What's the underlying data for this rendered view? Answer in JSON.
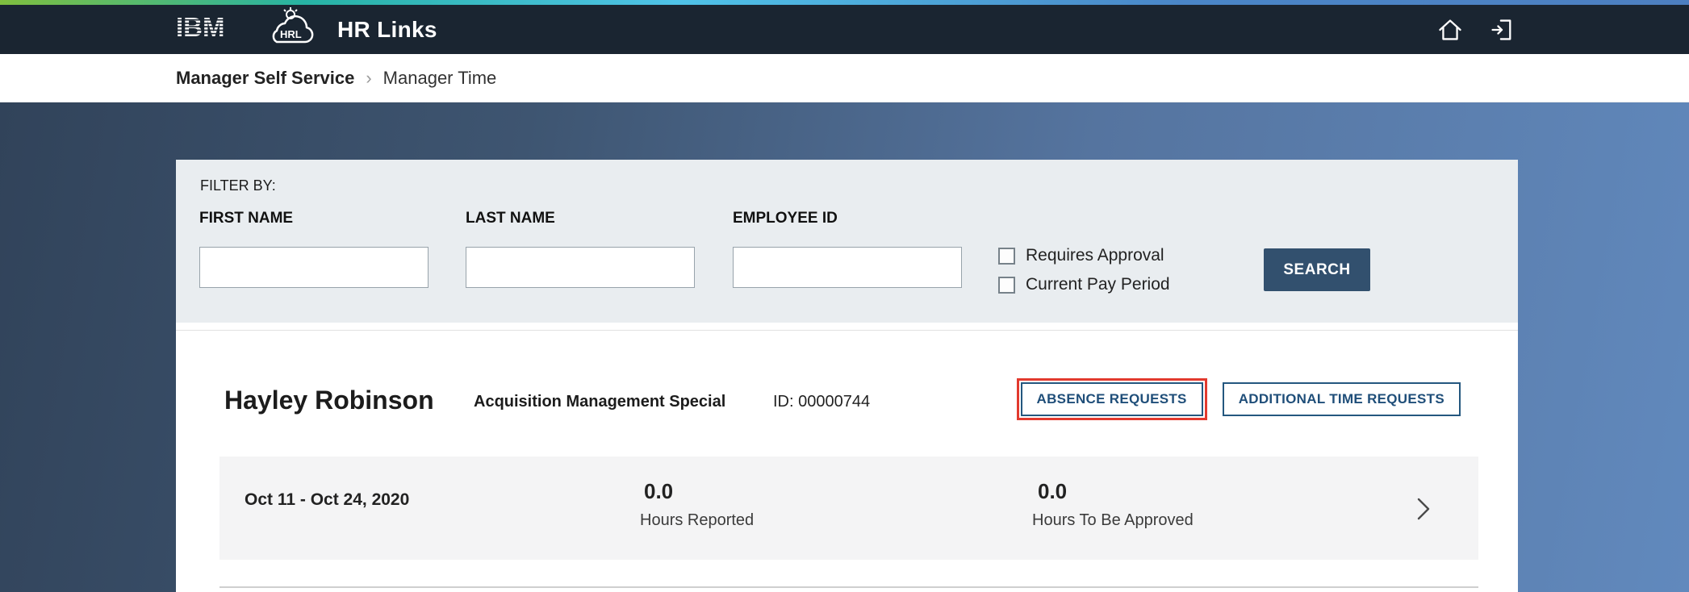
{
  "header": {
    "brand": "IBM",
    "app_name": "HR Links"
  },
  "breadcrumb": {
    "items": [
      "Manager Self Service",
      "Manager Time"
    ],
    "separator": "›"
  },
  "filter": {
    "title": "FILTER BY:",
    "fields": [
      {
        "label": "FIRST NAME",
        "value": ""
      },
      {
        "label": "LAST NAME",
        "value": ""
      },
      {
        "label": "EMPLOYEE ID",
        "value": ""
      }
    ],
    "checkboxes": [
      {
        "label": "Requires Approval",
        "checked": false
      },
      {
        "label": "Current Pay Period",
        "checked": false
      }
    ],
    "search_label": "SEARCH"
  },
  "employee": {
    "name": "Hayley Robinson",
    "title": "Acquisition Management Special",
    "id": "ID: 00000744",
    "actions": [
      {
        "label": "ABSENCE REQUESTS",
        "highlighted": true
      },
      {
        "label": "ADDITIONAL TIME REQUESTS",
        "highlighted": false
      }
    ]
  },
  "pay_periods": [
    {
      "date_range": "Oct 11 - Oct 24, 2020",
      "hours_reported": "0.0",
      "hours_reported_label": "Hours Reported",
      "hours_to_be_approved": "0.0",
      "hours_to_be_approved_label": "Hours To Be Approved"
    }
  ],
  "colors": {
    "header_bg": "#1a2531",
    "accent_navy": "#1f4e79",
    "search_button_bg": "#32506e",
    "highlight_red": "#e23a2e",
    "gradient_left": "#31435a",
    "gradient_right": "#6189bd"
  }
}
